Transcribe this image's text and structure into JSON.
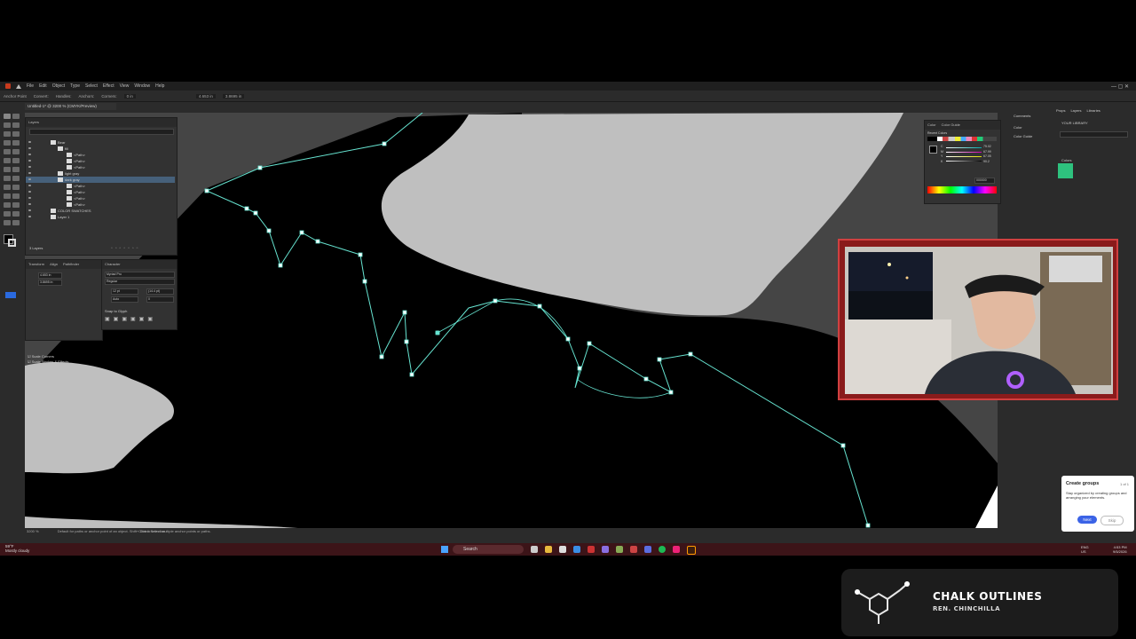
{
  "app": {
    "menu": [
      "File",
      "Edit",
      "Object",
      "Type",
      "Select",
      "Effect",
      "View",
      "Window",
      "Help"
    ],
    "control_bar": {
      "selection_label": "Anchor Point",
      "convert_label": "Convert:",
      "handles_label": "Handles:",
      "anchors_label": "Anchors:",
      "corners_label": "Corners:",
      "corners_value": "0 in",
      "x_value": "4.653 in",
      "y_value": "3.8695 in"
    },
    "document_tab": "Untitled-1* @ 3200 % (CMYK/Preview)",
    "layers_panel": {
      "title": "Layers",
      "rows": [
        {
          "name": "Bear",
          "depth": 0
        },
        {
          "name": "fill",
          "depth": 1
        },
        {
          "name": "<Path>",
          "depth": 2
        },
        {
          "name": "<Path>",
          "depth": 2
        },
        {
          "name": "<Path>",
          "depth": 2
        },
        {
          "name": "light gray",
          "depth": 1
        },
        {
          "name": "dark gray",
          "depth": 1,
          "selected": true
        },
        {
          "name": "<Path>",
          "depth": 2
        },
        {
          "name": "<Path>",
          "depth": 2
        },
        {
          "name": "<Path>",
          "depth": 2
        },
        {
          "name": "<Path>",
          "depth": 2
        },
        {
          "name": "COLOR SWATCHES",
          "depth": 0
        },
        {
          "name": "Layer 1",
          "depth": 0
        }
      ],
      "footer": "3 Layers"
    },
    "transform_panel": {
      "tabs": [
        "Transform",
        "Align",
        "Pathfinder"
      ],
      "x": "4.653 in",
      "y": "3.8695 in",
      "scale_corners": "Scale Corners",
      "scale_strokes": "Scale Strokes & Effects"
    },
    "character_panel": {
      "tab": "Character",
      "font": "Myriad Pro",
      "style": "Regular",
      "size": "12 pt",
      "leading": "(14.4 pt)",
      "tracking": "Auto",
      "kerning": "0",
      "snap": "Snap to Glyph"
    },
    "color_panel": {
      "tabs": [
        "Color",
        "Color Guide"
      ],
      "recent": "Recent Colors",
      "hex": "000000",
      "channels": [
        "C",
        "M",
        "Y",
        "K"
      ],
      "values": [
        "75.02",
        "67.99",
        "67.05",
        "90.2"
      ]
    },
    "right_tabs": {
      "comments": "Comments",
      "color": "Color",
      "color_guide": "Color Guide",
      "libraries_tabs": [
        "Props",
        "Layers",
        "Libraries"
      ],
      "your_library": "YOUR LIBRARY",
      "colors_label": "Colors",
      "swatch_color": "#2ec27e"
    },
    "status": "Default for paths or anchor point of an object. Shift+Click to select multiple anchor points or paths.",
    "status_zoom": "3200 %",
    "status_tool": "Direct Selection",
    "tip": {
      "title": "Create groups",
      "count": "1 of 1",
      "body": "Stay organized by creating groups and arranging your elements.",
      "next": "Next",
      "skip": "Skip"
    }
  },
  "taskbar": {
    "weather_temp": "59°F",
    "weather_desc": "Mostly cloudy",
    "search_placeholder": "Search",
    "lang": "ENG",
    "region": "US",
    "time": "4:53 PM",
    "date": "9/5/2026"
  },
  "overlay": {
    "title": "CHALK OUTLINES",
    "subtitle": "REN. CHINCHILLA"
  },
  "colors": {
    "path_highlight": "#66e3d0",
    "app_bg": "#2b2b2b",
    "canvas_dark_gray": "#454545",
    "canvas_light_gray": "#bfbfbf",
    "taskbar": "#3c1418",
    "webcam_frame": "#d04040"
  }
}
